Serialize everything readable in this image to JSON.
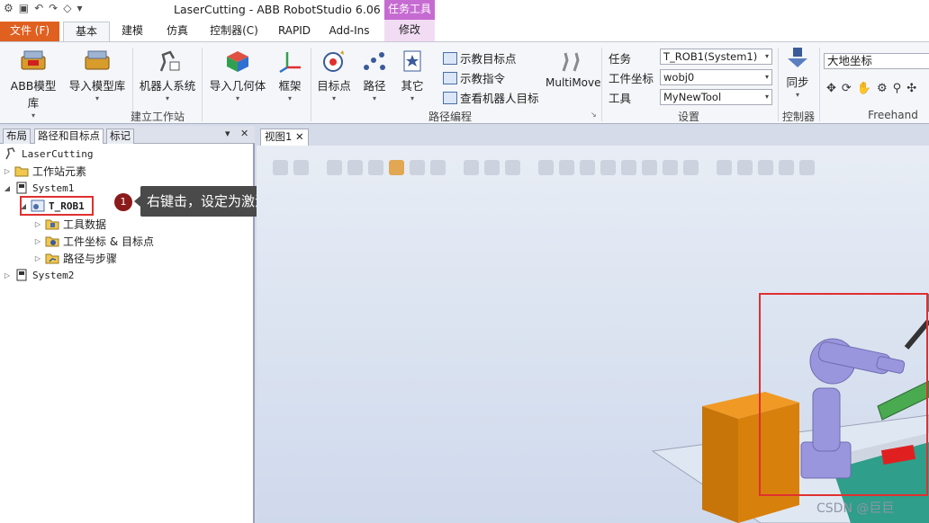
{
  "app": {
    "title": "LaserCutting - ABB RobotStudio 6.06",
    "context_tab_group": "任务工具"
  },
  "tabs": {
    "file": "文件 (F)",
    "items": [
      "基本",
      "建模",
      "仿真",
      "控制器(C)",
      "RAPID",
      "Add-Ins"
    ],
    "context": "修改"
  },
  "ribbon": {
    "build_station": {
      "label": "建立工作站",
      "abb_library": "ABB模型库",
      "import_library": "导入模型库",
      "robot_system": "机器人系统",
      "import_geometry": "导入几何体",
      "frame": "框架"
    },
    "path_programming": {
      "label": "路径编程",
      "target": "目标点",
      "path": "路径",
      "other": "其它",
      "teach_target": "示教目标点",
      "teach_instruction": "示教指令",
      "view_robot_target": "查看机器人目标",
      "multimove": "MultiMove"
    },
    "settings": {
      "label": "设置",
      "task_label": "任务",
      "task_value": "T_ROB1(System1)",
      "wobj_label": "工件坐标",
      "wobj_value": "wobj0",
      "tool_label": "工具",
      "tool_value": "MyNewTool"
    },
    "controller": {
      "label": "控制器",
      "sync": "同步"
    },
    "freehand": {
      "label": "Freehand",
      "coord_value": "大地坐标"
    }
  },
  "left_panel": {
    "tabs": [
      "布局",
      "路径和目标点",
      "标记"
    ],
    "tree": {
      "station": "LaserCutting",
      "station_elements": "工作站元素",
      "system1": "System1",
      "task": "T_ROB1",
      "tool_data": "工具数据",
      "wobj_targets": "工件坐标 & 目标点",
      "paths_procedures": "路径与步骤",
      "system2": "System2"
    }
  },
  "callout": {
    "number": "1",
    "text": "右键击，设定为激活状态，确认"
  },
  "viewport": {
    "tab_label": "视图1"
  },
  "watermark": "CSDN @巨巨",
  "colors": {
    "file_tab": "#e06020",
    "context_tab": "#c66bd1",
    "highlight": "#e03030",
    "robot": "#8f8fd8",
    "box": "#d87f0e"
  }
}
